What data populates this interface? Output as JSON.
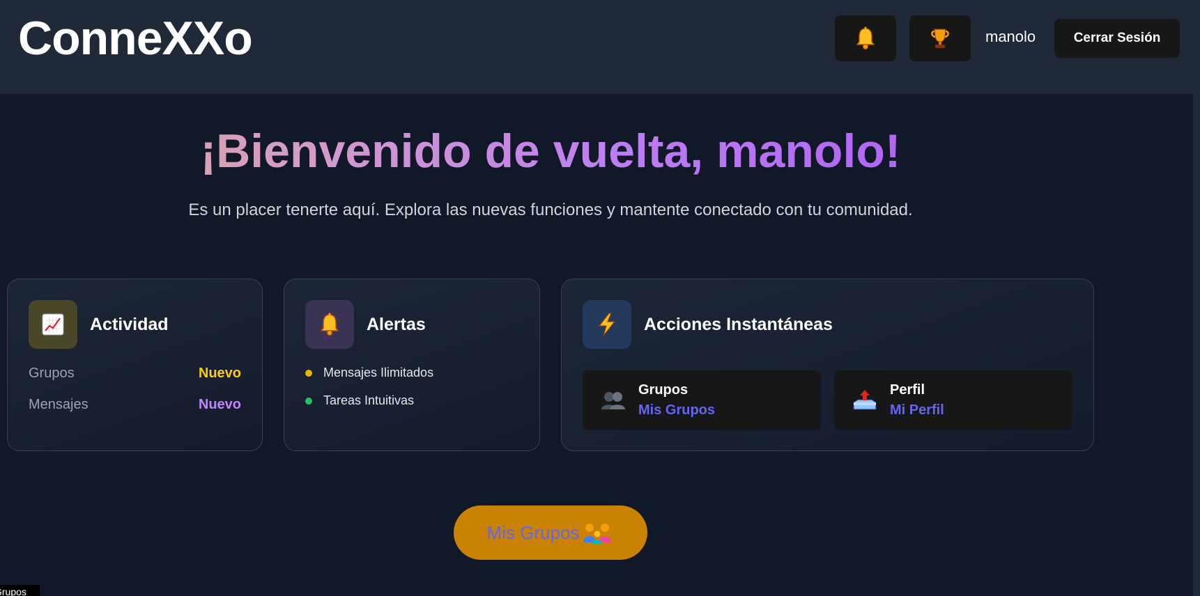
{
  "header": {
    "logo": "ConneXXo",
    "notifications_icon": "bell-icon",
    "achievements_icon": "trophy-icon",
    "username": "manolo",
    "logout_label": "Cerrar Sesión"
  },
  "hero": {
    "title": "¡Bienvenido de vuelta, manolo!",
    "subtitle": "Es un placer tenerte aquí. Explora las nuevas funciones y mantente conectado con tu comunidad."
  },
  "activity": {
    "icon": "chart-increasing-icon",
    "title": "Actividad",
    "stats": [
      {
        "label": "Grupos",
        "value": "Nuevo",
        "color": "#facc15"
      },
      {
        "label": "Mensajes",
        "value": "Nuevo",
        "color": "#c084fc"
      }
    ]
  },
  "alerts": {
    "icon": "bell-icon",
    "title": "Alertas",
    "items": [
      {
        "label": "Mensajes Ilimitados",
        "color": "#eab308"
      },
      {
        "label": "Tareas Intuitivas",
        "color": "#22c55e"
      }
    ]
  },
  "actions": {
    "icon": "lightning-icon",
    "title": "Acciones Instantáneas",
    "tiles": [
      {
        "title": "Grupos",
        "link": "Mis Grupos",
        "icon": "people-icon"
      },
      {
        "title": "Perfil",
        "link": "Mi Perfil",
        "icon": "outbox-tray-icon"
      }
    ]
  },
  "cta": {
    "label": "Mis Grupos",
    "icon": "family-icon"
  },
  "corner_tooltip": "Grupos",
  "colors": {
    "background": "#111827",
    "header": "#1f2937",
    "accent_link": "#6366f1",
    "cta": "#ca8205"
  }
}
